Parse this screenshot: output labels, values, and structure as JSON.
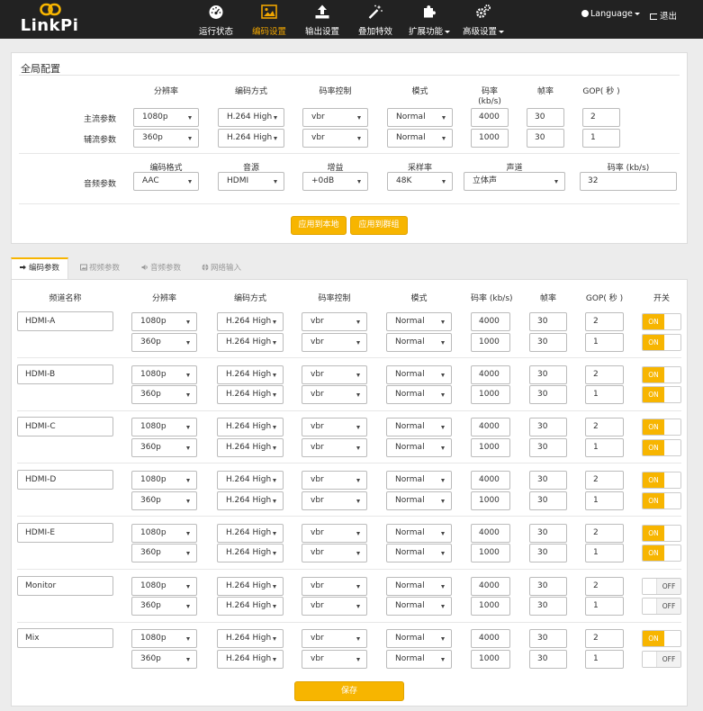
{
  "app": {
    "logo_text": "LinkPi",
    "nav": [
      {
        "label": "运行状态",
        "icon": "dashboard-icon"
      },
      {
        "label": "编码设置",
        "icon": "image-icon",
        "active": true
      },
      {
        "label": "输出设置",
        "icon": "upload-icon"
      },
      {
        "label": "叠加特效",
        "icon": "magic-wand-icon"
      },
      {
        "label": "扩展功能",
        "icon": "puzzle-icon",
        "dropdown": true
      },
      {
        "label": "高级设置",
        "icon": "gears-icon",
        "dropdown": true
      }
    ],
    "language_label": "Language",
    "logout_label": "退出"
  },
  "global": {
    "title": "全局配置",
    "video_headers": [
      "分辨率",
      "编码方式",
      "码率控制",
      "模式",
      "码率\n(kb/s)",
      "帧率",
      "GOP( 秒 )"
    ],
    "main_label": "主流参数",
    "sub_label": "辅流参数",
    "main": {
      "resolution": "1080p",
      "codec": "H.264 High",
      "rc": "vbr",
      "mode": "Normal",
      "bitrate": "4000",
      "fps": "30",
      "gop": "2"
    },
    "sub": {
      "resolution": "360p",
      "codec": "H.264 High",
      "rc": "vbr",
      "mode": "Normal",
      "bitrate": "1000",
      "fps": "30",
      "gop": "1"
    },
    "audio_headers": [
      "编码格式",
      "音源",
      "增益",
      "采样率",
      "声道",
      "码率 (kb/s)"
    ],
    "audio_label": "音频参数",
    "audio": {
      "format": "AAC",
      "source": "HDMI",
      "gain": "+0dB",
      "samplerate": "48K",
      "channel": "立体声",
      "bitrate": "32"
    },
    "apply_local": "应用到本地",
    "apply_group": "应用到群组"
  },
  "tabs": [
    {
      "label": "编码参数",
      "icon": "sign-in-icon",
      "active": true
    },
    {
      "label": "视频参数",
      "icon": "picture-icon"
    },
    {
      "label": "音频参数",
      "icon": "volume-icon"
    },
    {
      "label": "网络输入",
      "icon": "globe-icon"
    }
  ],
  "encode": {
    "headers": [
      "频道名称",
      "分辨率",
      "编码方式",
      "码率控制",
      "模式",
      "码率 (kb/s)",
      "帧率",
      "GOP( 秒 )",
      "开关"
    ],
    "toggle_on_label": "ON",
    "toggle_off_label": "OFF",
    "channels": [
      {
        "name": "HDMI-A",
        "streams": [
          {
            "resolution": "1080p",
            "codec": "H.264 High",
            "rc": "vbr",
            "mode": "Normal",
            "bitrate": "4000",
            "fps": "30",
            "gop": "2",
            "on": true
          },
          {
            "resolution": "360p",
            "codec": "H.264 High",
            "rc": "vbr",
            "mode": "Normal",
            "bitrate": "1000",
            "fps": "30",
            "gop": "1",
            "on": true
          }
        ]
      },
      {
        "name": "HDMI-B",
        "streams": [
          {
            "resolution": "1080p",
            "codec": "H.264 High",
            "rc": "vbr",
            "mode": "Normal",
            "bitrate": "4000",
            "fps": "30",
            "gop": "2",
            "on": true
          },
          {
            "resolution": "360p",
            "codec": "H.264 High",
            "rc": "vbr",
            "mode": "Normal",
            "bitrate": "1000",
            "fps": "30",
            "gop": "1",
            "on": true
          }
        ]
      },
      {
        "name": "HDMI-C",
        "streams": [
          {
            "resolution": "1080p",
            "codec": "H.264 High",
            "rc": "vbr",
            "mode": "Normal",
            "bitrate": "4000",
            "fps": "30",
            "gop": "2",
            "on": true
          },
          {
            "resolution": "360p",
            "codec": "H.264 High",
            "rc": "vbr",
            "mode": "Normal",
            "bitrate": "1000",
            "fps": "30",
            "gop": "1",
            "on": true
          }
        ]
      },
      {
        "name": "HDMI-D",
        "streams": [
          {
            "resolution": "1080p",
            "codec": "H.264 High",
            "rc": "vbr",
            "mode": "Normal",
            "bitrate": "4000",
            "fps": "30",
            "gop": "2",
            "on": true
          },
          {
            "resolution": "360p",
            "codec": "H.264 High",
            "rc": "vbr",
            "mode": "Normal",
            "bitrate": "1000",
            "fps": "30",
            "gop": "1",
            "on": true
          }
        ]
      },
      {
        "name": "HDMI-E",
        "streams": [
          {
            "resolution": "1080p",
            "codec": "H.264 High",
            "rc": "vbr",
            "mode": "Normal",
            "bitrate": "4000",
            "fps": "30",
            "gop": "2",
            "on": true
          },
          {
            "resolution": "360p",
            "codec": "H.264 High",
            "rc": "vbr",
            "mode": "Normal",
            "bitrate": "1000",
            "fps": "30",
            "gop": "1",
            "on": true
          }
        ]
      },
      {
        "name": "Monitor",
        "streams": [
          {
            "resolution": "1080p",
            "codec": "H.264 High",
            "rc": "vbr",
            "mode": "Normal",
            "bitrate": "4000",
            "fps": "30",
            "gop": "2",
            "on": false
          },
          {
            "resolution": "360p",
            "codec": "H.264 High",
            "rc": "vbr",
            "mode": "Normal",
            "bitrate": "1000",
            "fps": "30",
            "gop": "1",
            "on": false
          }
        ]
      },
      {
        "name": "Mix",
        "streams": [
          {
            "resolution": "1080p",
            "codec": "H.264 High",
            "rc": "vbr",
            "mode": "Normal",
            "bitrate": "4000",
            "fps": "30",
            "gop": "2",
            "on": true
          },
          {
            "resolution": "360p",
            "codec": "H.264 High",
            "rc": "vbr",
            "mode": "Normal",
            "bitrate": "1000",
            "fps": "30",
            "gop": "1",
            "on": false
          }
        ]
      }
    ],
    "save_label": "保存"
  },
  "colors": {
    "accent": "#f7b500",
    "navbar": "#222222",
    "active_nav_text": "#f0a500"
  }
}
